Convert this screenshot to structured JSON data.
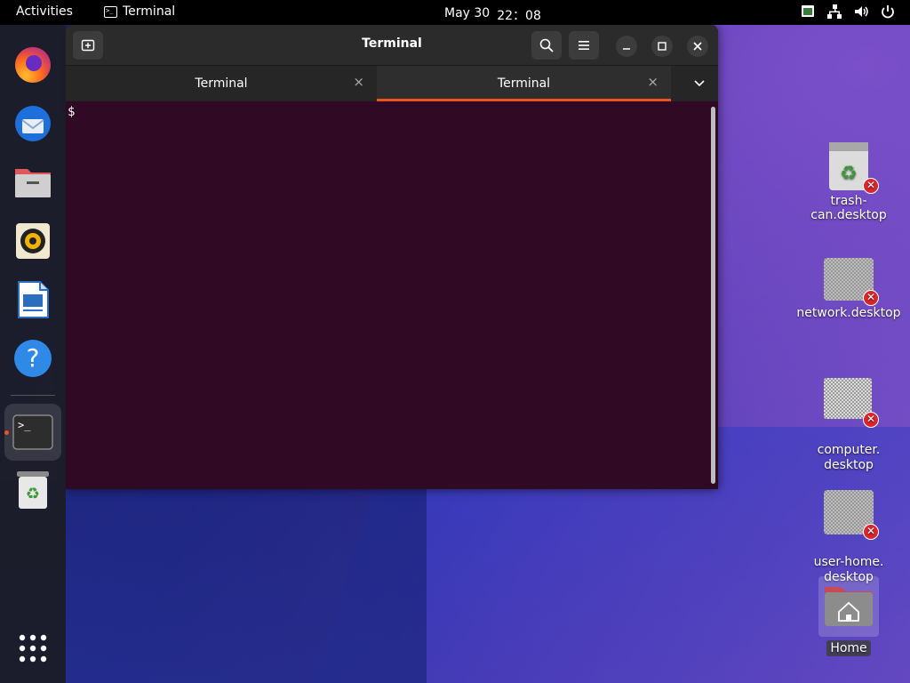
{
  "topbar": {
    "activities": "Activities",
    "app_name": "Terminal",
    "date": "May 30",
    "time": "22：08",
    "tray_icons": [
      "input-method-icon",
      "network-wired-icon",
      "volume-icon",
      "power-icon"
    ]
  },
  "dock": {
    "items": [
      {
        "name": "firefox-icon"
      },
      {
        "name": "thunderbird-icon"
      },
      {
        "name": "files-icon"
      },
      {
        "name": "rhythmbox-icon"
      },
      {
        "name": "libreoffice-writer-icon"
      },
      {
        "name": "help-icon",
        "glyph": "?"
      },
      {
        "name": "terminal-icon",
        "glyph": ">_"
      },
      {
        "name": "trash-icon"
      },
      {
        "name": "show-apps-icon"
      }
    ]
  },
  "window": {
    "title": "Terminal",
    "tabs": [
      {
        "label": "Terminal",
        "active": false
      },
      {
        "label": "Terminal",
        "active": true
      }
    ],
    "tab_close": "×",
    "prompt": "$"
  },
  "desktop_icons": [
    {
      "label": "trash-can.desktop",
      "broken": true
    },
    {
      "label": "network.desktop",
      "broken": true
    },
    {
      "label": "computer.\ndesktop",
      "broken": true
    },
    {
      "label": "user-home.\ndesktop",
      "broken": true
    },
    {
      "label": "Home",
      "broken": false
    }
  ],
  "colors": {
    "accent": "#e95420",
    "terminal_bg": "#300a24",
    "topbar_bg": "#000000"
  }
}
